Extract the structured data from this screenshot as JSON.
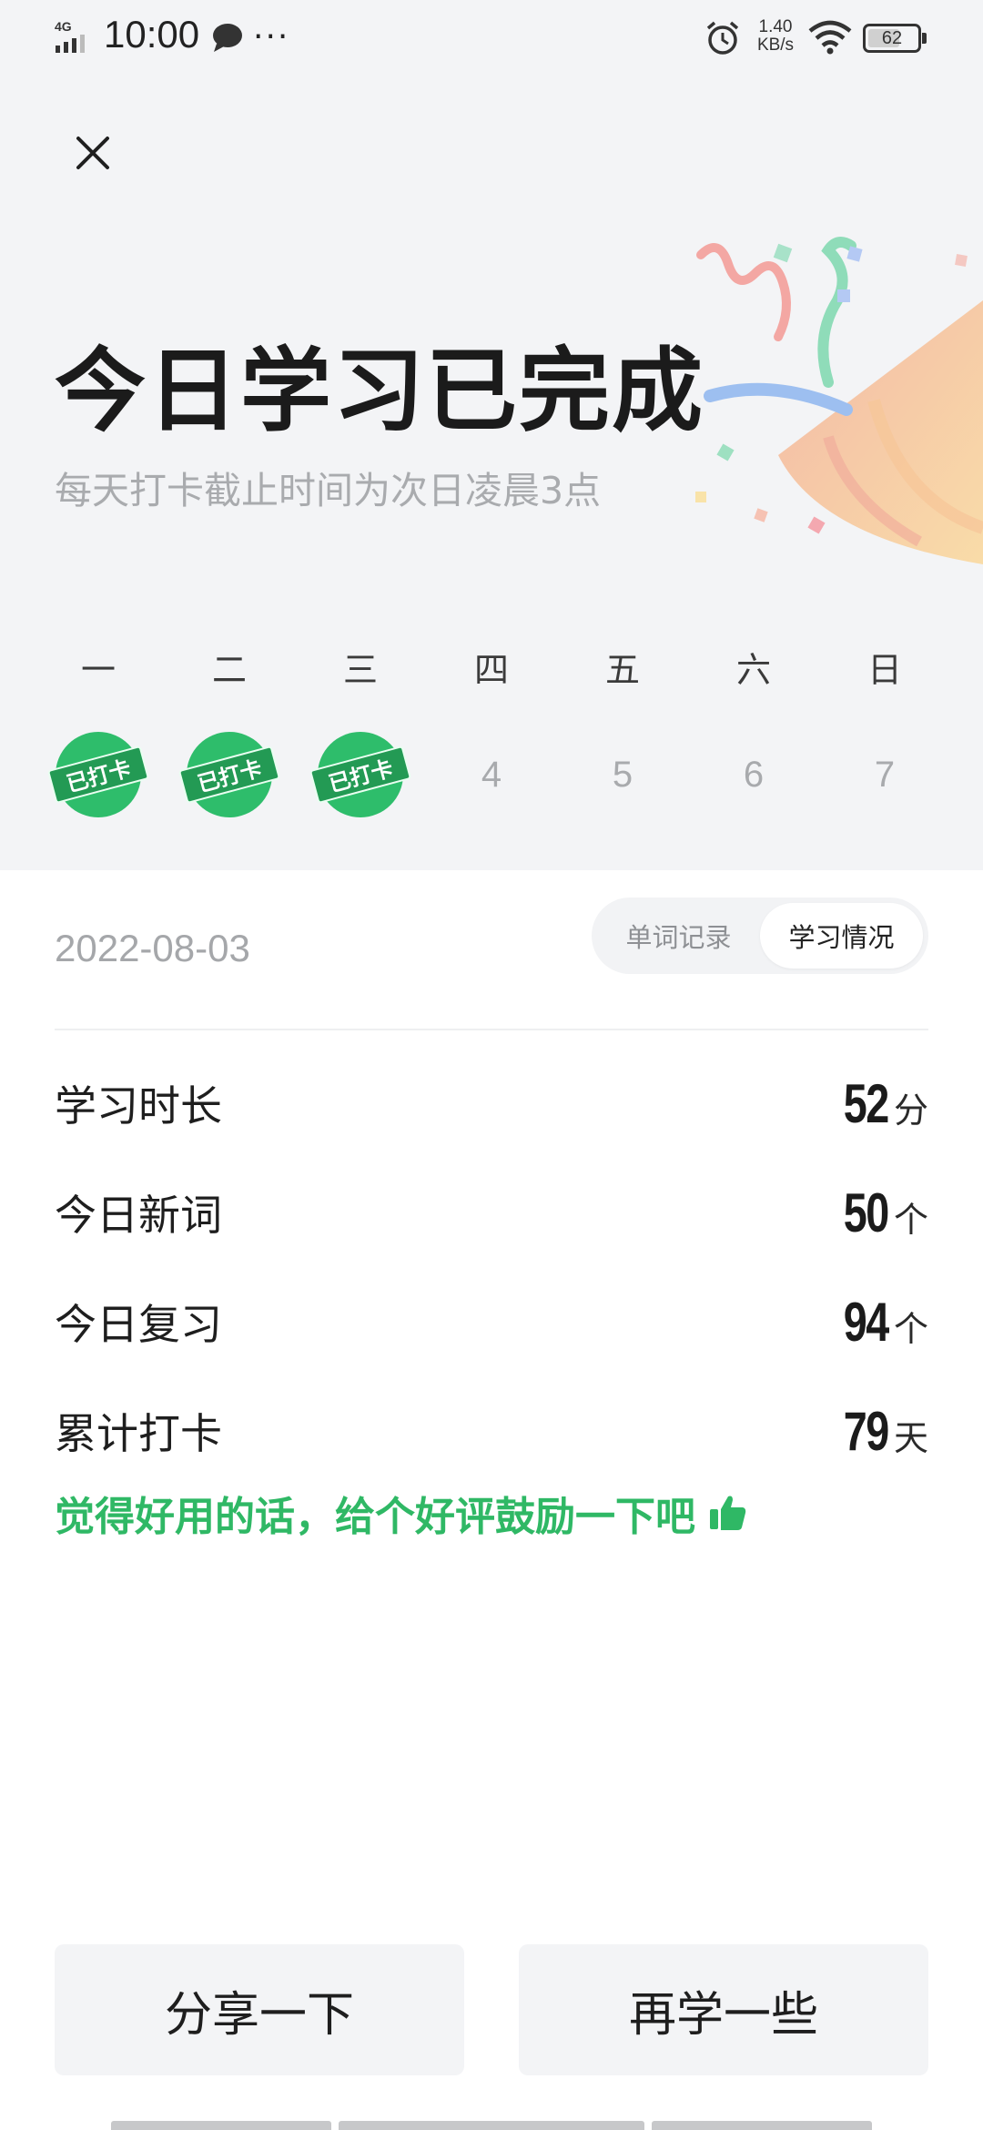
{
  "status_bar": {
    "network": "4G",
    "time": "10:00",
    "more": "···",
    "speed_value": "1.40",
    "speed_unit": "KB/s",
    "battery": "62"
  },
  "hero": {
    "title": "今日学习已完成",
    "subtitle": "每天打卡截止时间为次日凌晨3点"
  },
  "week": {
    "days": [
      {
        "label": "一",
        "checked": true,
        "stamp_text": "已打卡"
      },
      {
        "label": "二",
        "checked": true,
        "stamp_text": "已打卡"
      },
      {
        "label": "三",
        "checked": true,
        "stamp_text": "已打卡"
      },
      {
        "label": "四",
        "checked": false,
        "num": "4"
      },
      {
        "label": "五",
        "checked": false,
        "num": "5"
      },
      {
        "label": "六",
        "checked": false,
        "num": "6"
      },
      {
        "label": "日",
        "checked": false,
        "num": "7"
      }
    ]
  },
  "date": "2022-08-03",
  "tabs": {
    "word_record": "单词记录",
    "study_status": "学习情况",
    "active": "study_status"
  },
  "stats": [
    {
      "label": "学习时长",
      "value": "52",
      "unit": "分"
    },
    {
      "label": "今日新词",
      "value": "50",
      "unit": "个"
    },
    {
      "label": "今日复习",
      "value": "94",
      "unit": "个"
    },
    {
      "label": "累计打卡",
      "value": "79",
      "unit": "天"
    }
  ],
  "review_prompt": "觉得好用的话，给个好评鼓励一下吧",
  "buttons": {
    "share": "分享一下",
    "learn_more": "再学一些"
  },
  "colors": {
    "accent_green": "#2fb865",
    "top_bg": "#f3f4f6"
  }
}
